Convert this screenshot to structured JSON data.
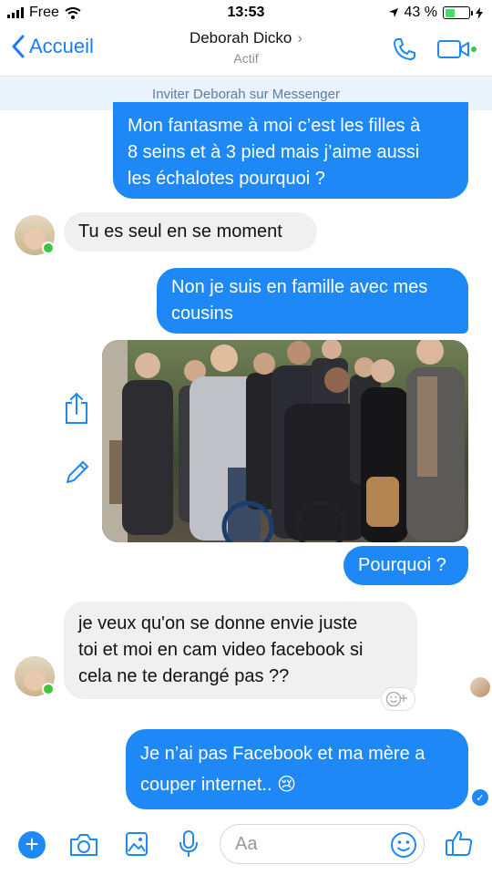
{
  "status_bar": {
    "carrier": "Free",
    "time": "13:53",
    "battery": "43 %",
    "battery_level": 0.43
  },
  "header": {
    "back_label": "Accueil",
    "contact_name": "Deborah Dicko",
    "contact_status": "Actif"
  },
  "invite_banner": "Inviter Deborah sur Messenger",
  "messages": [
    {
      "from": "me",
      "text": "Mon fantasme à moi c’est les filles à\n8 seins et à 3 pied mais j’aime aussi\nles échalotes pourquoi ?"
    },
    {
      "from": "them",
      "text": "Tu es seul en se moment"
    },
    {
      "from": "me",
      "text": "Non je suis en famille avec mes\ncousins"
    },
    {
      "from": "me",
      "type": "photo"
    },
    {
      "from": "me",
      "text": "Pourquoi ?"
    },
    {
      "from": "them",
      "text": "je veux qu'on se donne  envie  juste\ntoi et moi en cam video facebook  si\ncela ne te  derangé pas  ??"
    },
    {
      "from": "me",
      "text": "Je n’ai pas Facebook et ma mère a\ncouper internet.. 😢"
    }
  ],
  "composer": {
    "placeholder": "Aa"
  },
  "colors": {
    "accent": "#1e88f7",
    "incoming_bubble": "#f0f0f0",
    "banner": "#eaf2fb",
    "online": "#3ec43e"
  }
}
